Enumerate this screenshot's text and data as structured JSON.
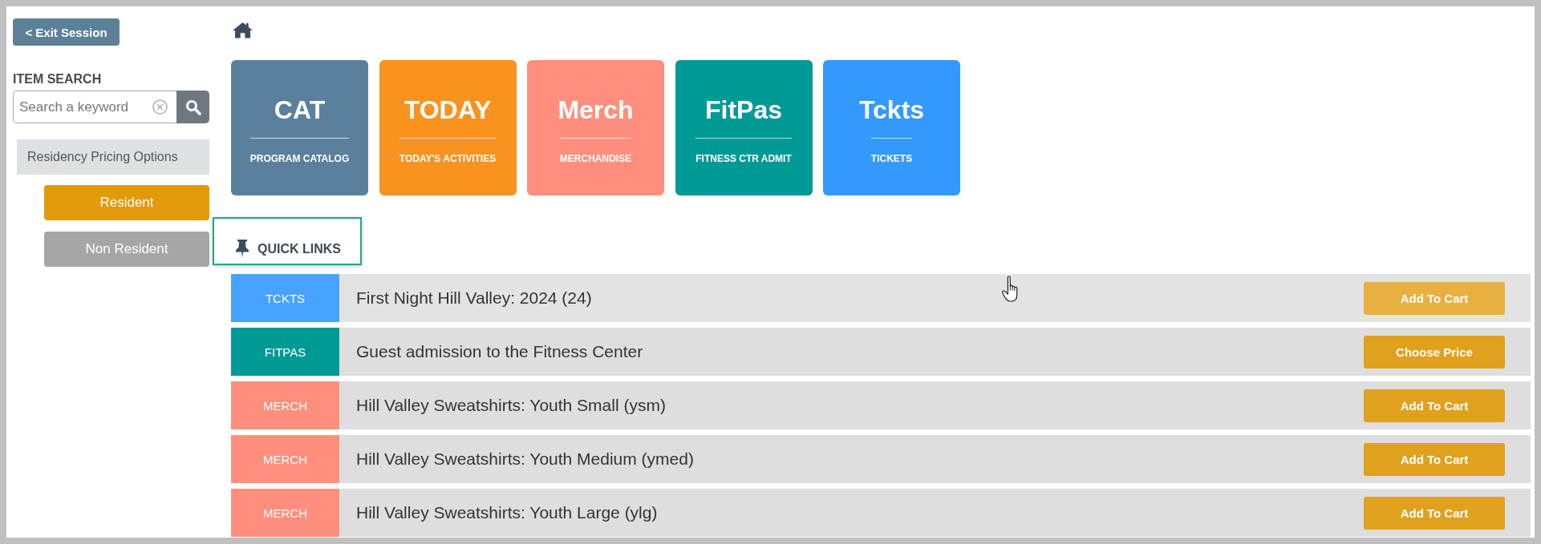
{
  "exit_button": "< Exit Session",
  "sidebar": {
    "search_label": "ITEM SEARCH",
    "search": {
      "placeholder": "Search a keyword"
    },
    "pricing_header": "Residency Pricing Options",
    "pricing_options": [
      {
        "label": "Resident",
        "selected": true
      },
      {
        "label": "Non Resident",
        "selected": false
      }
    ]
  },
  "tiles": [
    {
      "code": "CAT",
      "label": "PROGRAM CATALOG",
      "color": "#5b809b"
    },
    {
      "code": "TODAY",
      "label": "TODAY'S ACTIVITIES",
      "color": "#f7931e"
    },
    {
      "code": "Merch",
      "label": "MERCHANDISE",
      "color": "#ff8f7c"
    },
    {
      "code": "FitPas",
      "label": "FITNESS CTR ADMIT",
      "color": "#009a96"
    },
    {
      "code": "Tckts",
      "label": "TICKETS",
      "color": "#3399ff"
    }
  ],
  "quick_links": {
    "title": "QUICK LINKS",
    "focused": true,
    "rows": [
      {
        "tag": "TCKTS",
        "color": "#47a3ff",
        "title": "First Night Hill Valley: 2024 (24)",
        "action": "Add To Cart",
        "hovered": true
      },
      {
        "tag": "FITPAS",
        "color": "#009a96",
        "title": "Guest admission to the Fitness Center",
        "action": "Choose Price",
        "hovered": false
      },
      {
        "tag": "MERCH",
        "color": "#ff8f7c",
        "title": "Hill Valley Sweatshirts: Youth Small (ysm)",
        "action": "Add To Cart",
        "hovered": false
      },
      {
        "tag": "MERCH",
        "color": "#ff8f7c",
        "title": "Hill Valley Sweatshirts: Youth Medium (ymed)",
        "action": "Add To Cart",
        "hovered": false
      },
      {
        "tag": "MERCH",
        "color": "#ff8f7c",
        "title": "Hill Valley Sweatshirts: Youth Large (ylg)",
        "action": "Add To Cart",
        "hovered": false
      }
    ]
  }
}
